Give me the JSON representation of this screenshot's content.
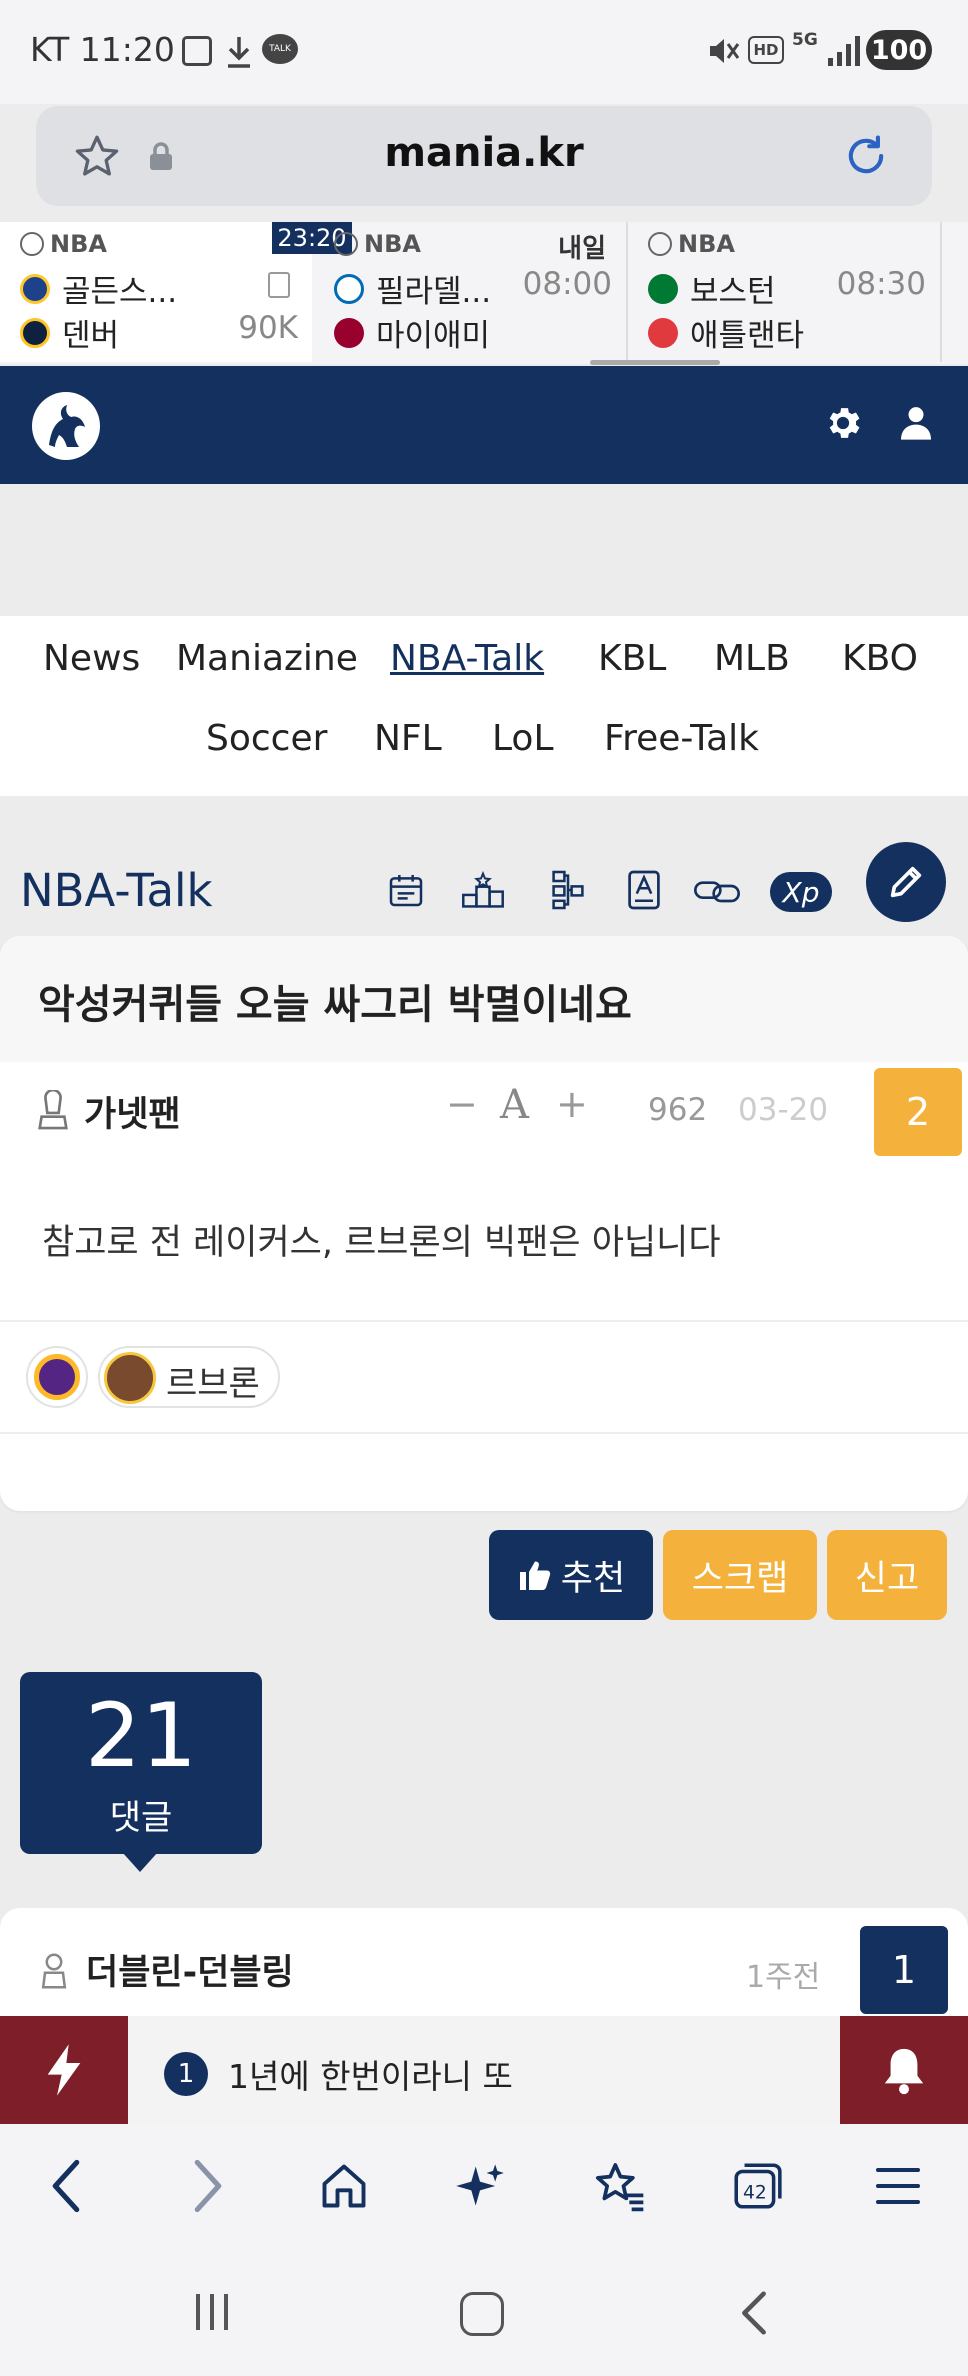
{
  "status_bar": {
    "carrier_time": "KT 11:20",
    "battery": "100",
    "hd_label": "HD",
    "network_label": "5G"
  },
  "url_bar": {
    "domain": "mania.kr"
  },
  "scores": [
    {
      "league": "NBA",
      "team1": "골든스...",
      "team2": "덴버",
      "right1": "",
      "right2": "90K",
      "clock": "23:20",
      "team1_color": "#1d428a",
      "team2_color": "#0e2240"
    },
    {
      "league": "NBA",
      "day": "내일",
      "team1": "필라델...",
      "team2": "마이애미",
      "right1": "08:00",
      "right2": "",
      "team1_color": "#006bb6",
      "team2_color": "#98002e"
    },
    {
      "league": "NBA",
      "team1": "보스턴",
      "team2": "애틀랜타",
      "right1": "08:30",
      "right2": "",
      "team1_color": "#007a33",
      "team2_color": "#e03a3e"
    }
  ],
  "nav": {
    "row1": [
      "News",
      "Maniazine",
      "NBA-Talk",
      "KBL",
      "MLB",
      "KBO"
    ],
    "row2": [
      "Soccer",
      "NFL",
      "LoL",
      "Free-Talk"
    ],
    "active": "NBA-Talk"
  },
  "board": {
    "title": "NBA-Talk",
    "xp_label": "Xp"
  },
  "post": {
    "title": "악성커퀴들 오늘 싸그리 박멸이네요",
    "author": "가넷팬",
    "font_minus": "−",
    "font_a": "A",
    "font_plus": "+",
    "views": "962",
    "date": "03-20",
    "vote_count": "2",
    "body": "참고로 전 레이커스, 르브론의 빅팬은 아닙니다",
    "tag_player": "르브론"
  },
  "actions": {
    "recommend": "추천",
    "scrap": "스크랩",
    "report": "신고"
  },
  "comments": {
    "count": "21",
    "label": "댓글",
    "first": {
      "author": "더블린-던블링",
      "time": "1주전",
      "vote": "1"
    }
  },
  "notice": {
    "badge": "1",
    "text": "1년에 한번이라니 또"
  },
  "colors": {
    "navy": "#13305f",
    "gold": "#f4b23c",
    "maroon": "#7d1e28"
  }
}
